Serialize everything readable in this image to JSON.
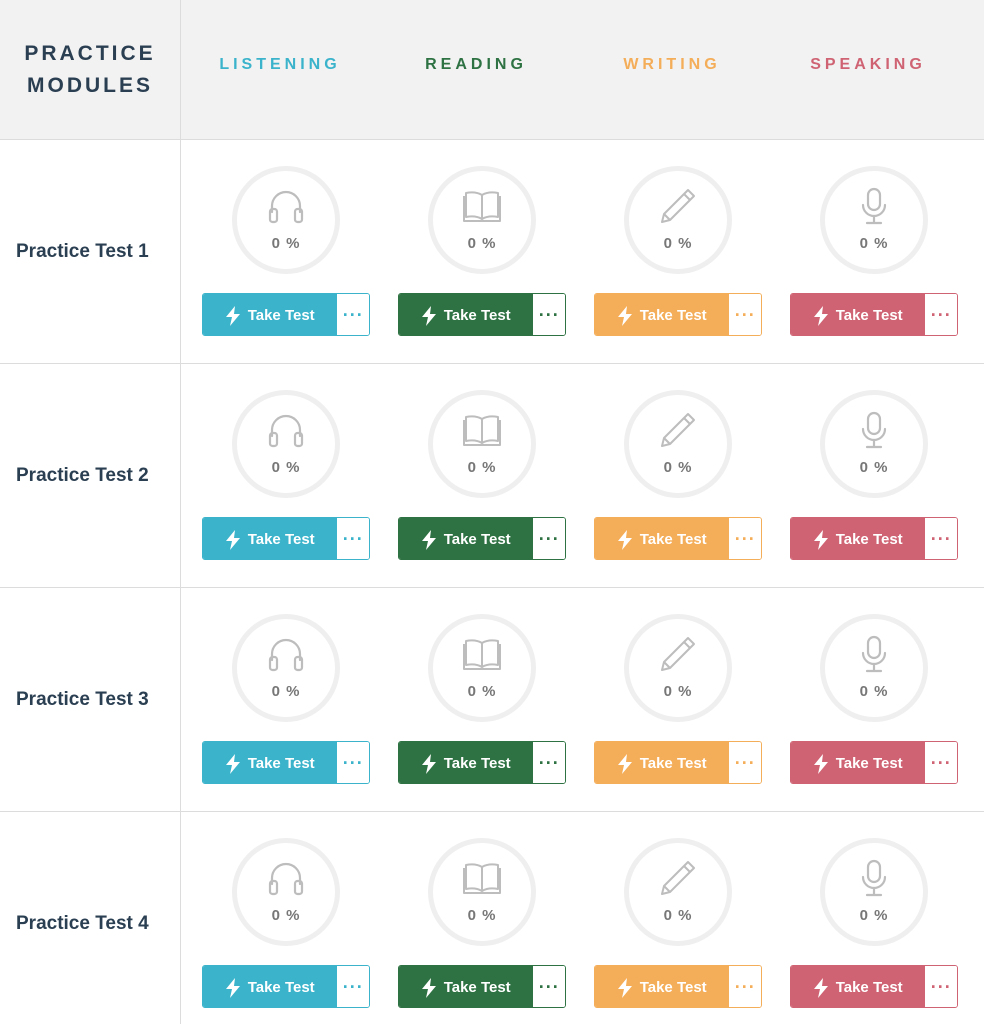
{
  "header": {
    "title": "PRACTICE\nMODULES",
    "columns": [
      {
        "label": "LISTENING",
        "color": "#3ab3cb",
        "icon": "headphones-icon"
      },
      {
        "label": "READING",
        "color": "#2e7243",
        "icon": "book-icon"
      },
      {
        "label": "WRITING",
        "color": "#f4ad58",
        "icon": "pencil-icon"
      },
      {
        "label": "SPEAKING",
        "color": "#cf6373",
        "icon": "microphone-icon"
      }
    ]
  },
  "rows": [
    {
      "label": "Practice Test 1",
      "progress": [
        "0 %",
        "0 %",
        "0 %",
        "0 %"
      ]
    },
    {
      "label": "Practice Test 2",
      "progress": [
        "0 %",
        "0 %",
        "0 %",
        "0 %"
      ]
    },
    {
      "label": "Practice Test 3",
      "progress": [
        "0 %",
        "0 %",
        "0 %",
        "0 %"
      ]
    },
    {
      "label": "Practice Test 4",
      "progress": [
        "0 %",
        "0 %",
        "0 %",
        "0 %"
      ]
    }
  ],
  "button": {
    "take_test_label": "Take Test",
    "more_label": "···"
  }
}
